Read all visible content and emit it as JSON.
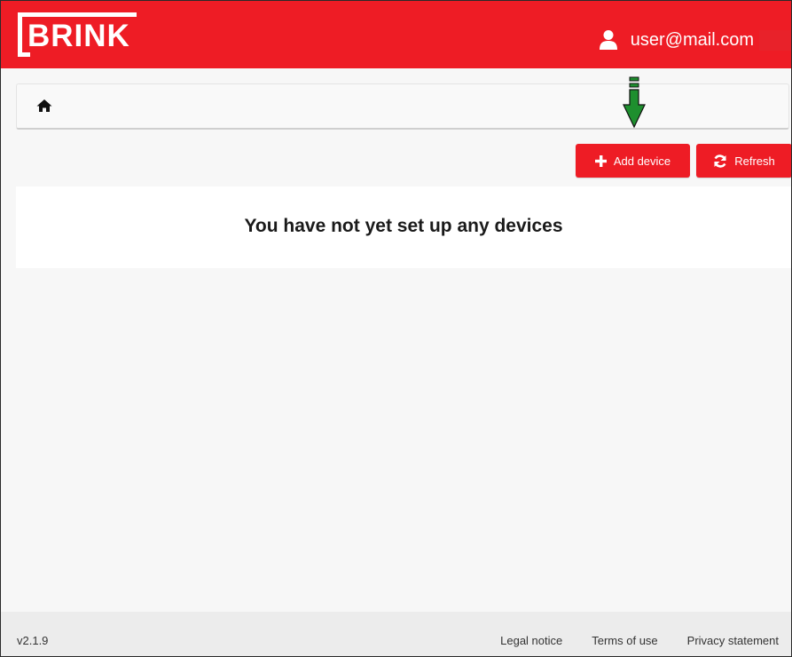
{
  "header": {
    "logo_text": "BRINK",
    "user_email": "user@mail.com",
    "brand_color": "#ee1c25"
  },
  "breadcrumb": {
    "home_icon": "home-icon"
  },
  "toolbar": {
    "add_label": "Add device",
    "add_icon": "plus-icon",
    "refresh_label": "Refresh",
    "refresh_icon": "refresh-icon"
  },
  "annotation": {
    "arrow_color": "#1e8f2e",
    "arrow_icon": "down-arrow-icon"
  },
  "main": {
    "empty_message": "You have not yet set up any devices"
  },
  "footer": {
    "version": "v2.1.9",
    "links": [
      "Legal notice",
      "Terms of use",
      "Privacy statement"
    ]
  }
}
